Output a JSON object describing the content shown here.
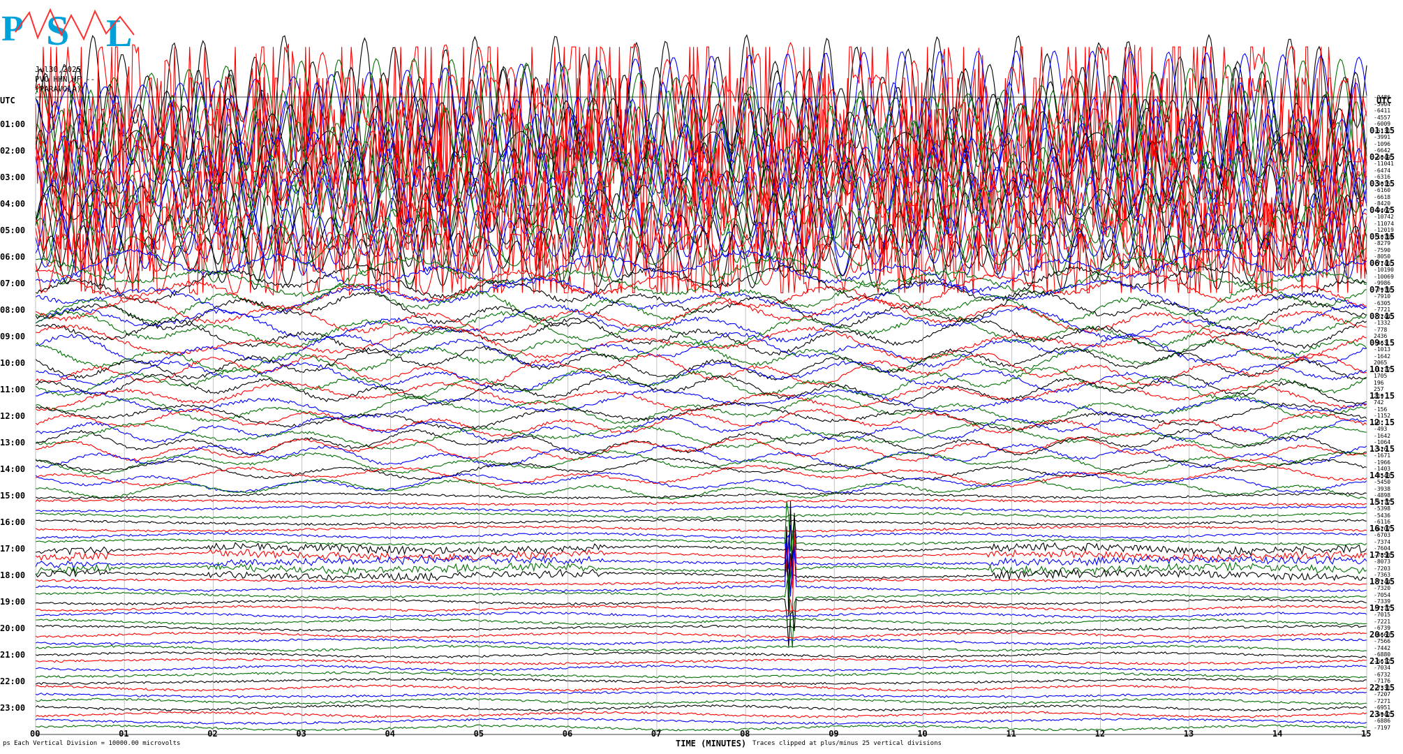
{
  "header": {
    "date": "Jul30,2025",
    "station": "PVO HHN HF --",
    "location": "(PARAVOLA)",
    "utc_left": "UTC",
    "utc_right": "UTC"
  },
  "logo": {
    "text": "PSL",
    "letters": [
      "P",
      "S",
      "L"
    ]
  },
  "footer": {
    "scale_note": "Each Vertical Division = 10000.00 microvolts",
    "clip_note": "Traces clipped at plus/minus 25 vertical divisions",
    "corner_mark": "ps"
  },
  "chart_data": {
    "type": "line",
    "title": "",
    "xlabel": "TIME (MINUTES)",
    "ylabel": "",
    "x_ticks": [
      "00",
      "01",
      "02",
      "03",
      "04",
      "05",
      "06",
      "07",
      "08",
      "09",
      "10",
      "11",
      "12",
      "13",
      "14",
      "15"
    ],
    "xlim": [
      0,
      15
    ],
    "grid": true,
    "colors": [
      "#000000",
      "#ff0000",
      "#0000ff",
      "#007000"
    ],
    "left_labels": [
      "UTC",
      "01:00",
      "02:00",
      "03:00",
      "04:00",
      "05:00",
      "06:00",
      "07:00",
      "08:00",
      "09:00",
      "10:00",
      "11:00",
      "12:00",
      "13:00",
      "14:00",
      "15:00",
      "16:00",
      "17:00",
      "18:00",
      "19:00",
      "20:00",
      "21:00",
      "22:00",
      "23:00"
    ],
    "right_labels": [
      "UTC",
      "01:15",
      "02:15",
      "03:15",
      "04:15",
      "05:15",
      "06:15",
      "07:15",
      "08:15",
      "09:15",
      "10:15",
      "11:15",
      "12:15",
      "13:15",
      "14:15",
      "15:15",
      "16:15",
      "17:15",
      "18:15",
      "19:15",
      "20:15",
      "21:15",
      "22:15",
      "23:15"
    ],
    "trace_means": [
      "-9486",
      "-5904",
      "-6411",
      "-4557",
      "-6009",
      "-6131",
      "-3991",
      "-1096",
      "-6642",
      "-6049",
      "-11041",
      "-6474",
      "-6316",
      "-3015",
      "-6160",
      "-6618",
      "-8420",
      "-9467",
      "-10742",
      "-11074",
      "-12019",
      "-10700",
      "-8279",
      "-7590",
      "-8050",
      "-7746",
      "-10190",
      "-10069",
      "-9986",
      "-7979",
      "-7910",
      "-6305",
      "-7721",
      "-2244",
      "-1332",
      "-778",
      "2436",
      "-463",
      "-1013",
      "-1642",
      "2065",
      "-1277",
      "1705",
      "196",
      "257",
      "219",
      "742",
      "-156",
      "-1152",
      "18",
      "-493",
      "-1642",
      "-1064",
      "-526",
      "-1671",
      "-1966",
      "-1403",
      "-4543",
      "-5450",
      "-3938",
      "-4898",
      "-5777",
      "-5398",
      "-5436",
      "-6116",
      "-6207",
      "-6703",
      "-7374",
      "-7604",
      "-7858",
      "-8073",
      "-7203",
      "-7363",
      "-7244",
      "-7320",
      "-7054",
      "-7339",
      "-7277",
      "-7015",
      "-7221",
      "-6739",
      "-6663",
      "-7566",
      "-7442",
      "-6880",
      "-6612",
      "-7034",
      "-6732",
      "-7176",
      "-7331",
      "-7207",
      "-7271",
      "-6951",
      "-6942",
      "-6886",
      "-7197"
    ],
    "series": [
      {
        "period": "00:00–06:30",
        "activity": "very large swings, clipped at ±25 divisions"
      },
      {
        "period": "07:00–14:00",
        "activity": "long-period microseism oscillations"
      },
      {
        "period": "17:00–18:00",
        "activity": "bursts of high-frequency noise"
      },
      {
        "period": "17:00 at minute 8.5",
        "activity": "large spike"
      }
    ]
  }
}
